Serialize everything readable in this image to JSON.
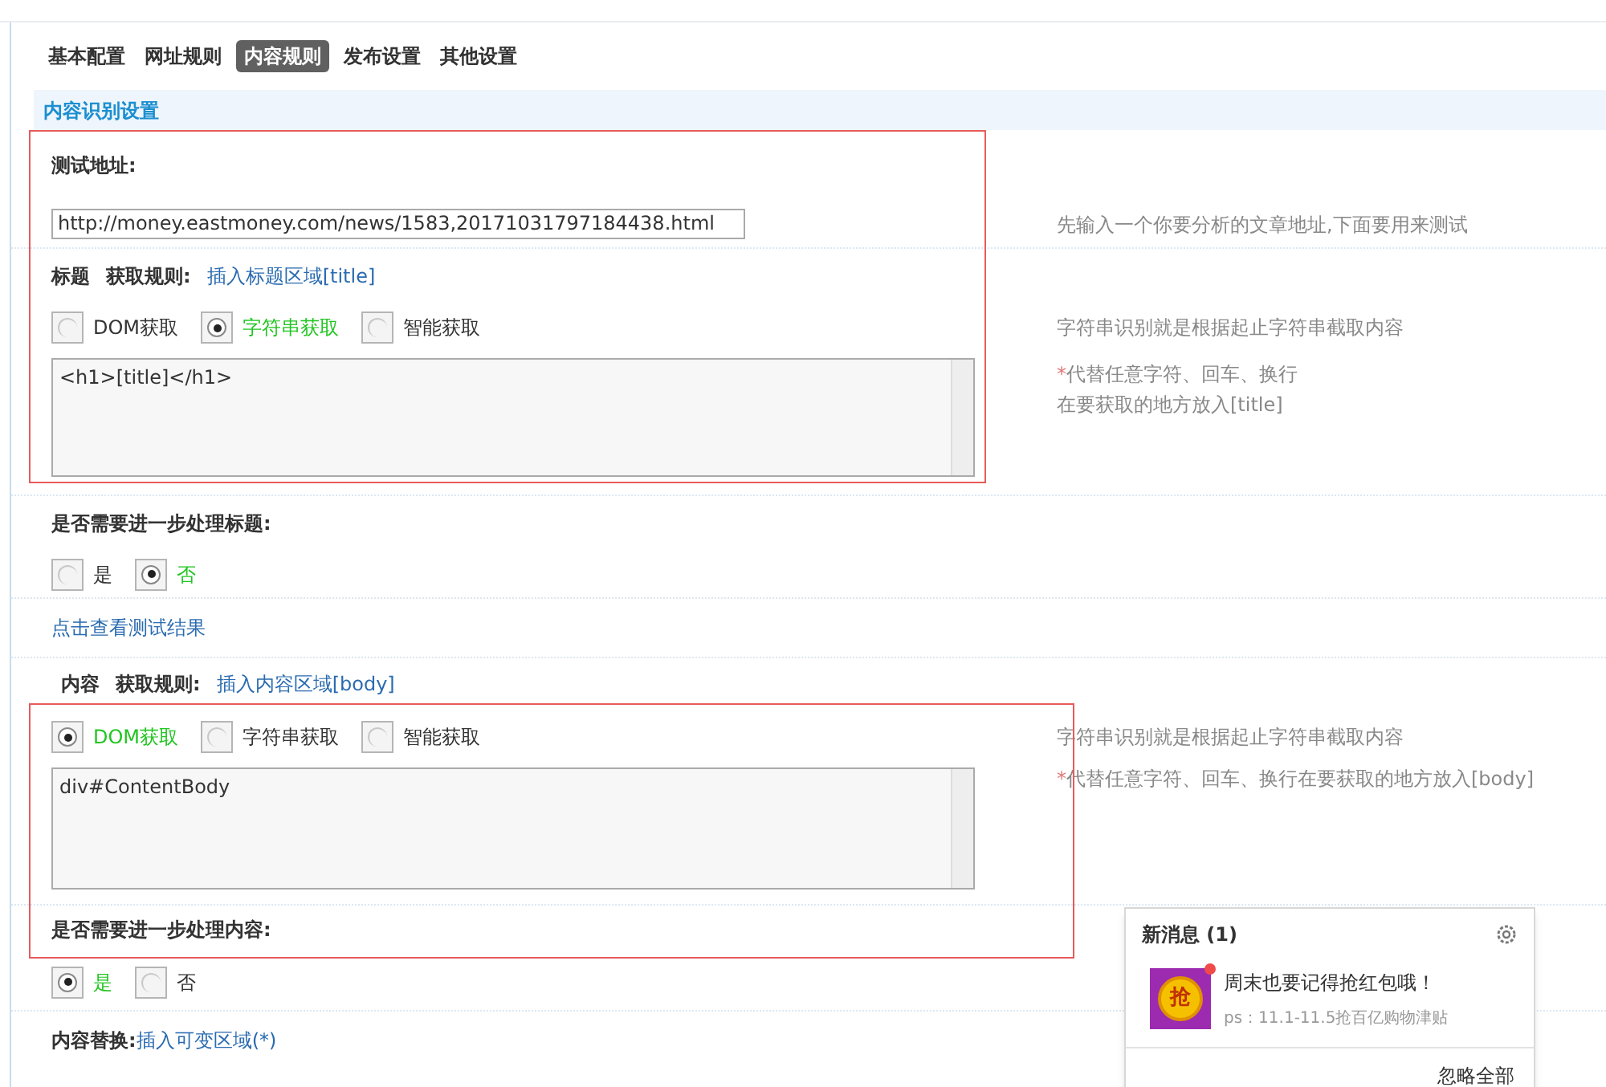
{
  "tabs": [
    {
      "label": "基本配置",
      "selected": false
    },
    {
      "label": "网址规则",
      "selected": false
    },
    {
      "label": "内容规则",
      "selected": true
    },
    {
      "label": "发布设置",
      "selected": false
    },
    {
      "label": "其他设置",
      "selected": false
    }
  ],
  "section_title": "内容识别设置",
  "test_url": {
    "label": "测试地址:",
    "value": "http://money.eastmoney.com/news/1583,20171031797184438.html",
    "hint": "先输入一个你要分析的文章地址,下面要用来测试"
  },
  "title_rule": {
    "field": "标题",
    "label": "获取规则:",
    "insert_link": "插入标题区域[title]",
    "options": [
      {
        "label": "DOM获取",
        "selected": false
      },
      {
        "label": "字符串获取",
        "selected": true
      },
      {
        "label": "智能获取",
        "selected": false
      }
    ],
    "rule": "<h1>[title]</h1>",
    "hint": "字符串识别就是根据起止字符串截取内容",
    "note_mark": "*",
    "note_lines": [
      "代替任意字符、回车、换行",
      "在要获取的地方放入[title]"
    ]
  },
  "title_postprocess": {
    "label": "是否需要进一步处理标题:",
    "options": [
      {
        "label": "是",
        "selected": false
      },
      {
        "label": "否",
        "selected": true
      }
    ]
  },
  "test_result_link": "点击查看测试结果",
  "content_rule": {
    "field": "内容",
    "label": "获取规则:",
    "insert_link": "插入内容区域[body]",
    "options": [
      {
        "label": "DOM获取",
        "selected": true
      },
      {
        "label": "字符串获取",
        "selected": false
      },
      {
        "label": "智能获取",
        "selected": false
      }
    ],
    "rule": "div#ContentBody",
    "hint": "字符串识别就是根据起止字符串截取内容",
    "note_mark": "*",
    "note_lines": [
      "代替任意字符、回车、换行在要获取的地方放入[body]"
    ]
  },
  "content_postprocess": {
    "label": "是否需要进一步处理内容:",
    "options": [
      {
        "label": "是",
        "selected": true
      },
      {
        "label": "否",
        "selected": false
      }
    ]
  },
  "replace": {
    "label": "内容替换:",
    "insert_link": "插入可变区域(*)"
  },
  "notification": {
    "title": "新消息 (1)",
    "badge": "抢",
    "message": "周末也要记得抢红包哦！",
    "detail": "ps：11.1-11.5抢百亿购物津贴",
    "dismiss_all": "忽略全部"
  }
}
